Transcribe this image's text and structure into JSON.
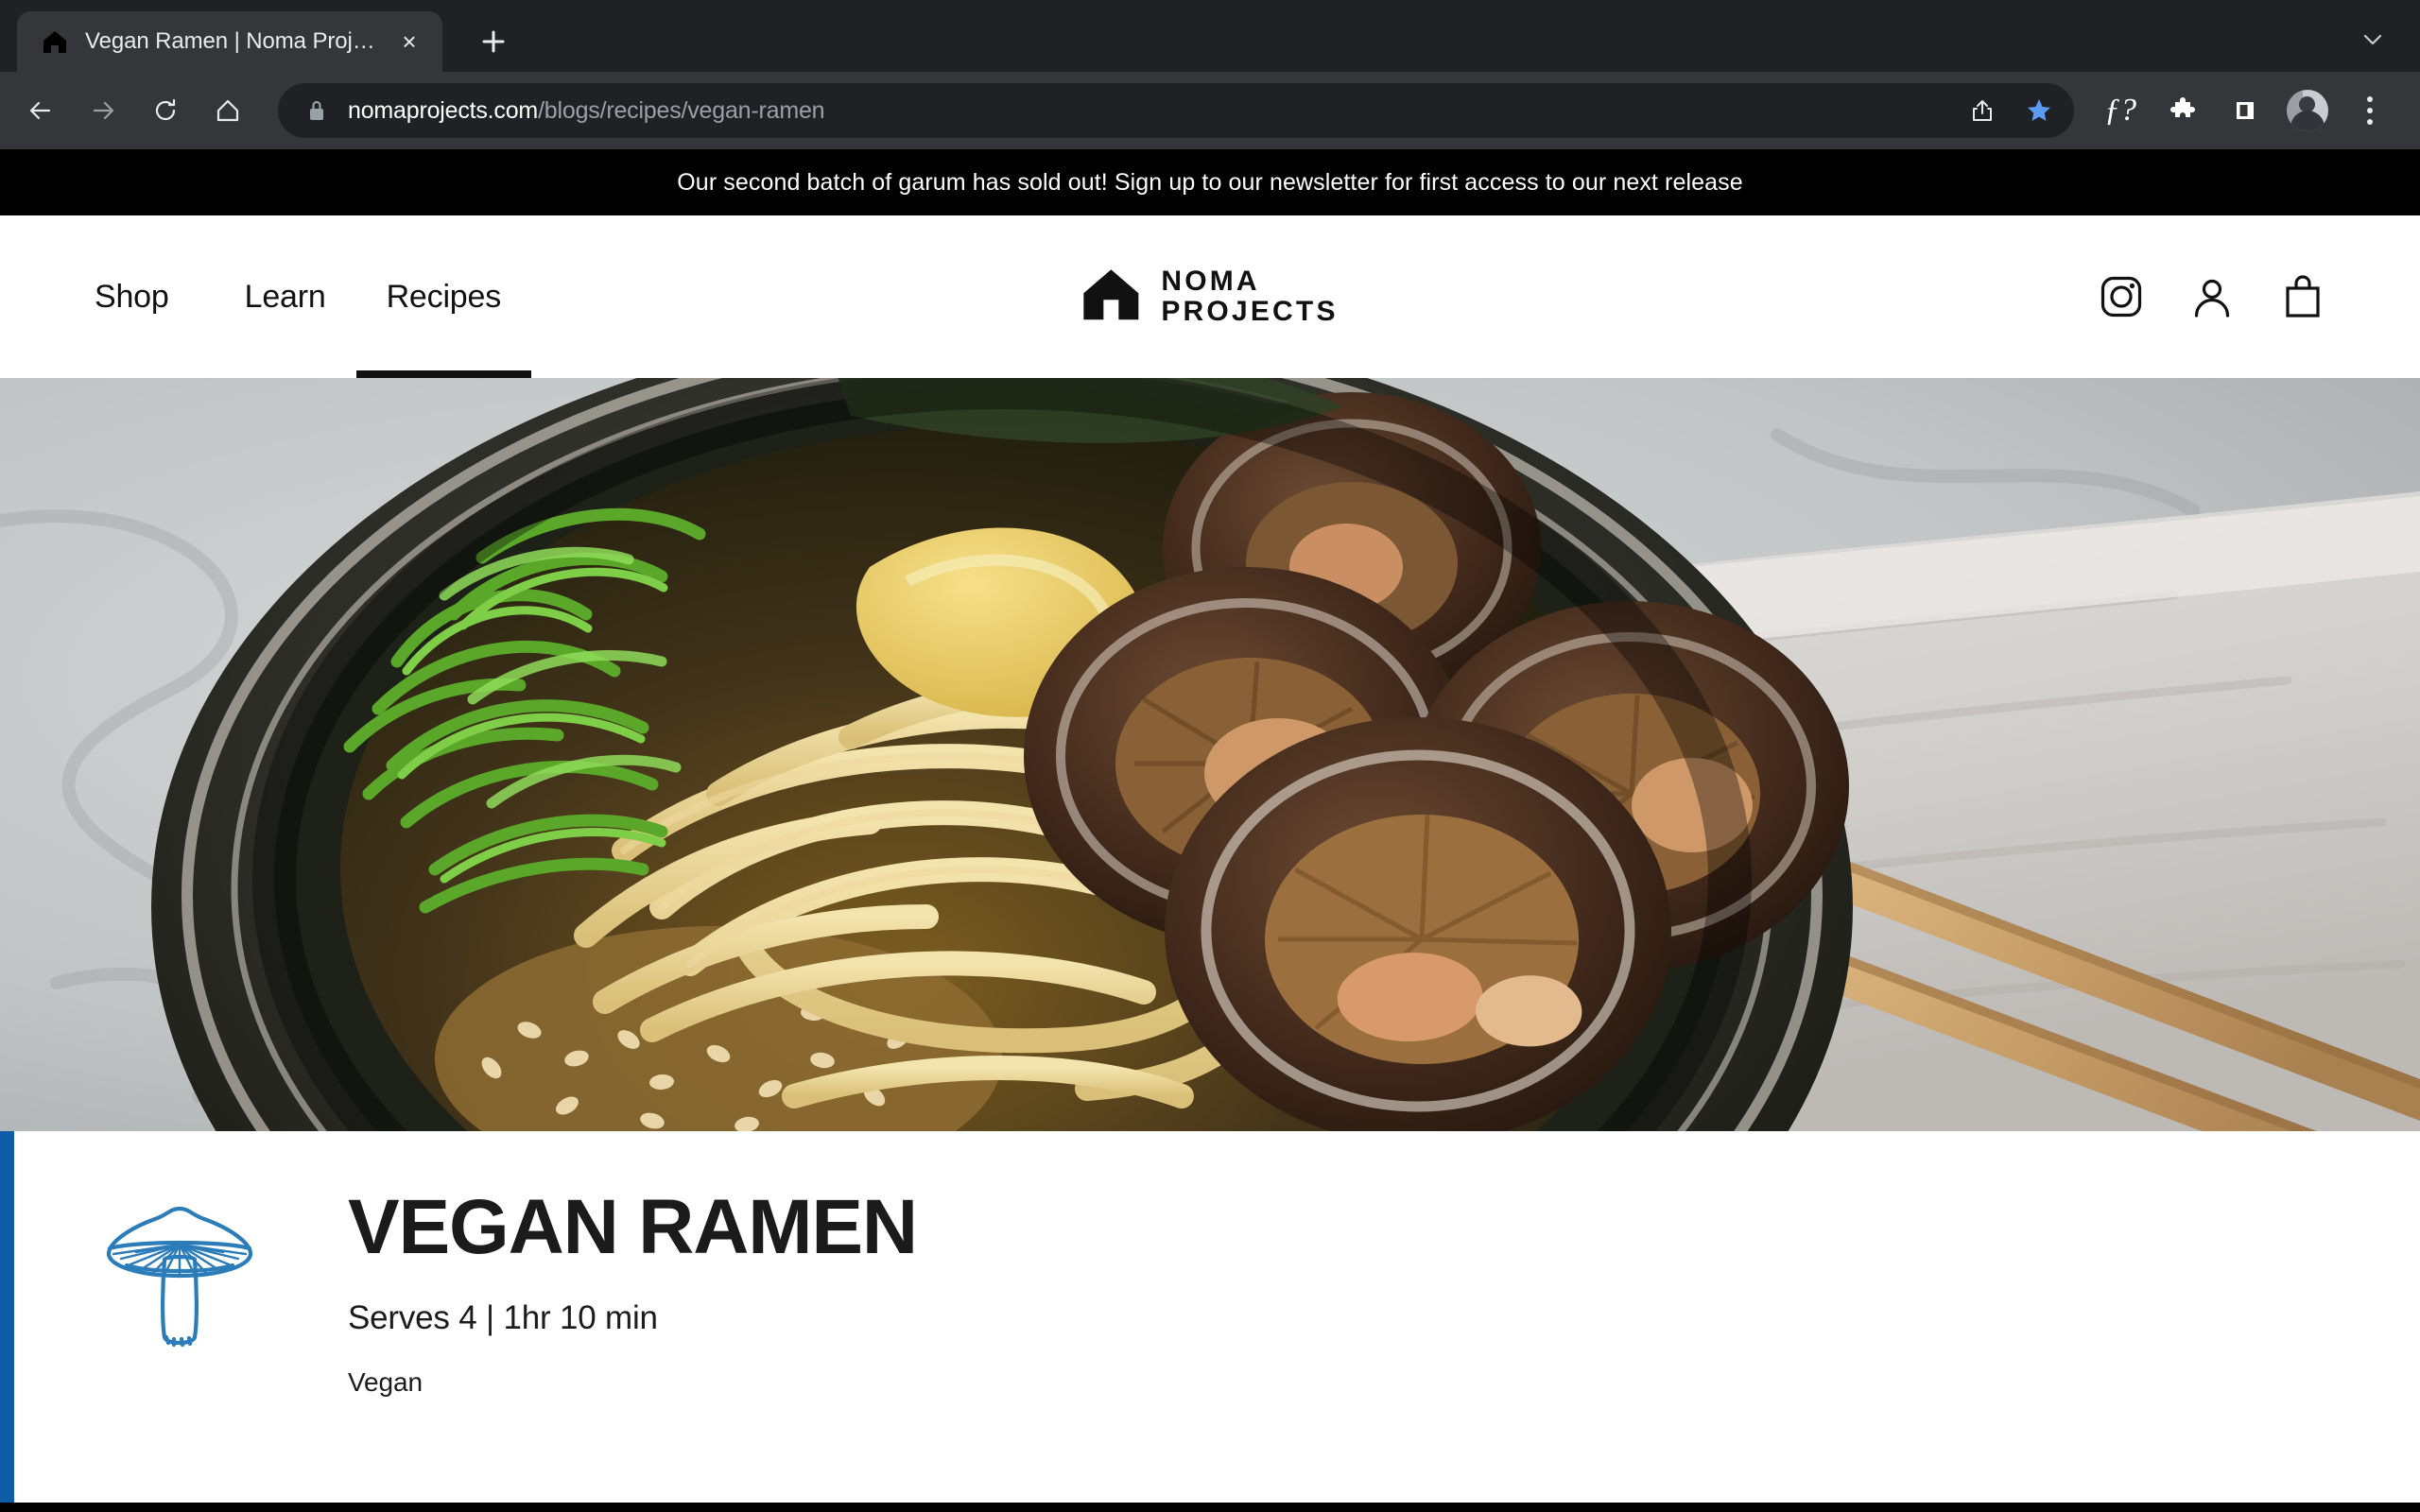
{
  "browser": {
    "tab": {
      "title": "Vegan Ramen | Noma Projects",
      "favicon_name": "noma-house-favicon",
      "close_label": "×"
    },
    "new_tab_label": "+",
    "tab_list_chevron": "⌄",
    "nav": {
      "back_label": "←",
      "forward_label": "→",
      "reload_label": "↻",
      "home_label": "⌂"
    },
    "omnibox": {
      "host": "nomaprojects.com",
      "path": "/blogs/recipes/vegan-ramen",
      "lock_icon": "secure-lock-icon",
      "share_icon": "share-icon",
      "bookmark_icon": "star-filled-icon",
      "bookmark_color": "#5B9BF2"
    },
    "extensions": [
      {
        "name": "font-inspector-extension",
        "glyph": "ƒ?"
      },
      {
        "name": "extensions-puzzle-icon",
        "glyph": "puzzle"
      },
      {
        "name": "side-panel-icon",
        "glyph": "square"
      }
    ],
    "profile": {
      "name": "profile-avatar"
    },
    "menu": {
      "name": "browser-menu-icon"
    }
  },
  "page": {
    "announcement": "Our second batch of garum has sold out! Sign up to our newsletter for first access to our next release",
    "header": {
      "nav_items": [
        {
          "label": "Shop",
          "active": false
        },
        {
          "label": "Learn",
          "active": false
        },
        {
          "label": "Recipes",
          "active": true
        }
      ],
      "logo": {
        "line1": "NOMA",
        "line2": "PROJECTS",
        "mark": "house-logo-mark"
      },
      "icons": [
        {
          "name": "instagram-icon"
        },
        {
          "name": "account-icon"
        },
        {
          "name": "cart-bag-icon"
        }
      ]
    },
    "hero": {
      "alt": "Bowl of vegan ramen with shiitake mushrooms, noodles, scallions and sesame seeds beside wooden chopsticks on linen"
    },
    "recipe": {
      "illustration": "mushroom-illustration",
      "illustration_color": "#2B7CB8",
      "title": "VEGAN RAMEN",
      "meta": "Serves 4 | 1hr 10 min",
      "tag": "Vegan",
      "accent_color": "#0F5CA8"
    }
  }
}
